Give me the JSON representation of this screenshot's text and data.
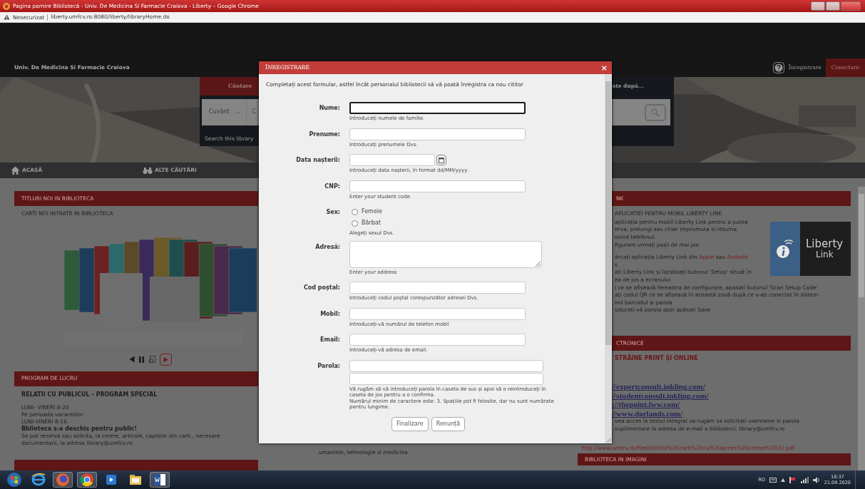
{
  "browser": {
    "title": "Pagina pornire Bibliotecă - Univ. De Medicina Si Farmacie Craiova - Liberty – Google Chrome",
    "security": "Nesecurizat",
    "url": "liberty.umfcv.ro:8080/liberty/libraryHome.do"
  },
  "site_header": {
    "title": "Univ. De Medicina Si Farmacie Craiova",
    "links": [
      {
        "label": "Înregistrare",
        "kind": "link"
      },
      {
        "label": "Conectare",
        "kind": "button"
      }
    ]
  },
  "search": {
    "tabs": [
      {
        "label": "Căutare",
        "selected": true
      },
      {
        "label": "ste după...",
        "selected": false
      }
    ],
    "select": "Cuvânt",
    "value": "C",
    "link": "Search this library"
  },
  "nav": [
    {
      "label": "ACASĂ"
    },
    {
      "label": "ALTE CĂUTĂRI"
    }
  ],
  "new_titles": {
    "header": "TITLURI NOI IN BIBLIOTECA",
    "subtitle": "CARTI NOI INTRATE IN BIBLIOTECA"
  },
  "hours": {
    "header": "PROGRAM DE LUCRU",
    "title": "RELATII CU PUBLICUL - PROGRAM SPECIAL",
    "lines": [
      "LUNI- VINERI 8-20",
      "Pe perioada vacantelor:",
      "LUNI-VINERI 8-16"
    ],
    "notice": "Bblioteca s-a deschis pentru public!",
    "note": "Se pot rezerva sau solicita, la cerere, articole, capitole din carti , necesare documentarii, la adresa library@umfcv.ro."
  },
  "middle_panel": {
    "text": "umaniste, tehnologie si medicina"
  },
  "liberty_link": {
    "header": "NK",
    "title": "APLICATIEI PENTRU MOBIL LIBERTY LINK",
    "logo": [
      "Liberty",
      "Link"
    ],
    "paragraphs": [
      [
        [
          {
            "text": "aplicația pentru mobil Liberty Link pentru a putea"
          }
        ],
        [
          {
            "text": "erva, prelungi sau chiar imprumuta si returna"
          }
        ],
        [
          {
            "text": "osind telefonul."
          }
        ],
        [
          {
            "text": "figurare urmați pașii de mai jos:"
          }
        ]
      ],
      [
        [
          {
            "text": "ărcați aplicația Liberty Link din "
          },
          {
            "text": "Apple",
            "link": true
          },
          {
            "text": " sau "
          },
          {
            "text": "Android",
            "link": true
          }
        ],
        [
          {
            "text": "s"
          }
        ],
        [
          {
            "text": "ați Liberty Link și localizați butonul 'Setup' situat în"
          }
        ],
        [
          {
            "text": "ea de jos a ecranului"
          }
        ],
        [
          {
            "text": "i ce se afișează fereastra de configurare, apasati butonul 'Scan Setup Code'"
          }
        ],
        [
          {
            "text": "ați codul QR ce se afișează în această zonă după ce v-ați conectat în sistem"
          }
        ],
        [
          {
            "text": "ind barcodul și parola"
          }
        ],
        [
          {
            "text": "oduceți-vă parola apoi apăsați Save"
          }
        ]
      ]
    ]
  },
  "resources": {
    "header": "CTRONICE",
    "title": "STRĂINE PRINT ȘI ONLINE",
    "links": [
      "//expertconsult.inkling.com/",
      "//studentconsult.inkling.com/",
      "://thepoint.lww.com/",
      "//www.dorlands.com/"
    ],
    "lines": [
      "vea acces la textul integral va rugăm sa solicitati username si parola .",
      "suplimentare la adresa de e-mail a bibliotecii: library@umfcv.ro"
    ],
    "pdf_link": "http://www.umfcv.ro/files/l/i/lista%20carti%20cu%20acces%20online%20(1).pdf"
  },
  "gallery": {
    "header": "BIBLIOTECA IN IMAGINI"
  },
  "modal": {
    "title": "ÎNREGISTRARE",
    "close": "×",
    "intro": "Completați acest formular, astfel încât personalul bibliotecii să vă poată înregistra ca nou cititor",
    "fields": [
      {
        "kind": "text",
        "label": "Nume:",
        "help": [
          "Introduceți numele de familie."
        ],
        "focused": true
      },
      {
        "kind": "text",
        "label": "Prenume:",
        "help": [
          "Introduceți prenumele Dvs."
        ],
        "focused": false
      },
      {
        "kind": "date",
        "label": "Data nașterii:",
        "help": [
          "Introduceți data nașterii, în format dd/MM/yyyy."
        ],
        "focused": false
      },
      {
        "kind": "text",
        "label": "CNP:",
        "help": [
          "Enter your student code."
        ],
        "focused": false
      },
      {
        "kind": "radio",
        "label": "Sex:",
        "options": [
          {
            "label": "Femeie",
            "checked": false
          },
          {
            "label": "Bărbat",
            "checked": false
          }
        ],
        "help": [
          "Alegeți sexul Dvs."
        ]
      },
      {
        "kind": "textarea",
        "label": "Adresă:",
        "help": [
          "Enter your address"
        ],
        "focused": false
      },
      {
        "kind": "text",
        "label": "Cod poștal:",
        "help": [
          "Introduceți codul poștal corespunzător adresei Dvs."
        ],
        "focused": false
      },
      {
        "kind": "text",
        "label": "Mobil:",
        "help": [
          "Introduceți-vă numărul de telefon mobil"
        ],
        "focused": false
      },
      {
        "kind": "text",
        "label": "Email:",
        "help": [
          "Introduceți-vă adresa de email."
        ],
        "focused": false
      },
      {
        "kind": "password",
        "label": "Parola:",
        "help": [
          "Vă rugăm să vă introduceți parola în caseta de sus și apoi să o reintroduceți în caseta de jos pentru a o confirma.",
          "Numărul minim de caractere este: 3. Spațiile pot fi folosite, dar nu sunt numărate pentru lungime."
        ],
        "focused": false
      }
    ],
    "buttons": [
      "Finalizare",
      "Renunță"
    ]
  },
  "taskbar": {
    "language": "RO",
    "time": "18:37",
    "date": "21.09.2020"
  }
}
